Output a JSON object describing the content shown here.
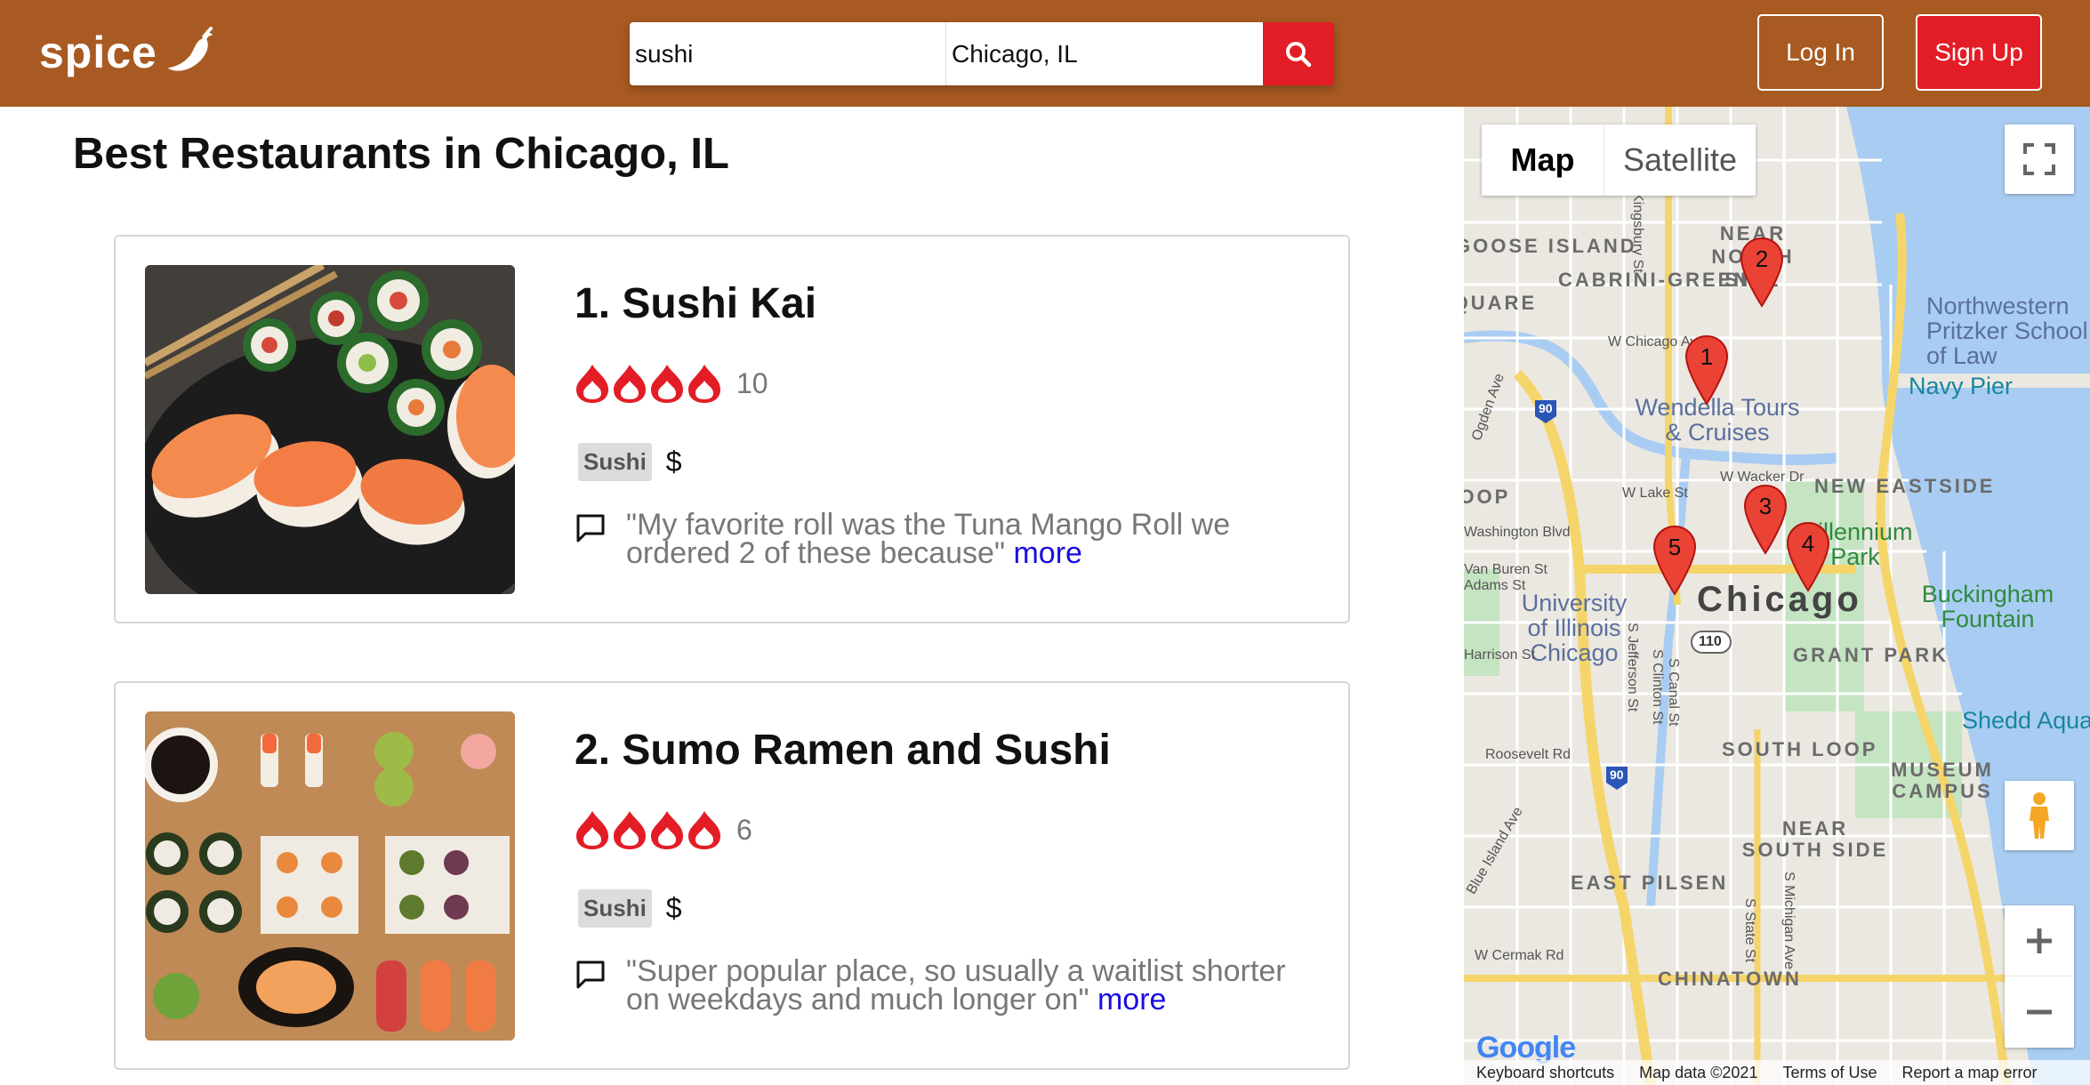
{
  "header": {
    "logo_text": "spice",
    "search_query": "sushi",
    "search_location": "Chicago, IL",
    "login_label": "Log In",
    "signup_label": "Sign Up"
  },
  "page_title": "Best Restaurants in Chicago, IL",
  "restaurants": [
    {
      "title": "1. Sushi Kai",
      "rating": 4,
      "review_count": "10",
      "category": "Sushi",
      "price": "$",
      "review": "\"My favorite roll was the Tuna Mango Roll we ordered 2 of these because\"",
      "more_label": "more"
    },
    {
      "title": "2. Sumo Ramen and Sushi",
      "rating": 4,
      "review_count": "6",
      "category": "Sushi",
      "price": "$",
      "review": "\"Super popular place, so usually a waitlist shorter on weekdays and much longer on\"",
      "more_label": "more"
    }
  ],
  "map": {
    "type_map": "Map",
    "type_satellite": "Satellite",
    "city_label": "Chicago",
    "neighborhoods": [
      "NEAR NORTH SIDE",
      "CABRINI-GREEN",
      "GOOSE ISLAND",
      "NEW EASTSIDE",
      "GRANT PARK",
      "SOUTH LOOP",
      "MUSEUM CAMPUS",
      "NEAR SOUTH SIDE",
      "EAST PILSEN",
      "CHINATOWN",
      "LOOP",
      "SQUARE"
    ],
    "pois": [
      "Northwestern Pritzker School of Law",
      "Navy Pier",
      "Wendella Tours & Cruises",
      "Millennium Park",
      "Buckingham Fountain",
      "University of Illinois Chicago",
      "Shedd Aquarium"
    ],
    "streets": [
      "W Chicago Ave",
      "W Lake St",
      "Washington Blvd",
      "W Wacker Dr",
      "Roosevelt Rd",
      "Blue Island Ave",
      "W Cermak Rd",
      "S Jefferson St",
      "S Clinton St",
      "S Canal St",
      "S State St",
      "S Michigan Ave",
      "Kingsbury St",
      "Ogden Ave",
      "Harrison St",
      "Van Buren St",
      "Adams St"
    ],
    "highway_shields": [
      "90",
      "90",
      "110"
    ],
    "markers": [
      "1",
      "2",
      "3",
      "4",
      "5"
    ],
    "footer": {
      "shortcuts": "Keyboard shortcuts",
      "data": "Map data ©2021",
      "terms": "Terms of Use",
      "report": "Report a map error"
    },
    "google_logo": "Google"
  },
  "colors": {
    "header_bg": "#a85a22",
    "brand_red": "#e31d26",
    "link_blue": "#1a0dde"
  },
  "icons": {
    "search": "search-icon",
    "chili": "chili-pepper-icon",
    "rating": "flame-icon",
    "review": "speech-bubble-icon",
    "fullscreen": "fullscreen-icon",
    "pegman": "street-view-pegman-icon",
    "zoom_in": "plus-icon",
    "zoom_out": "minus-icon"
  }
}
